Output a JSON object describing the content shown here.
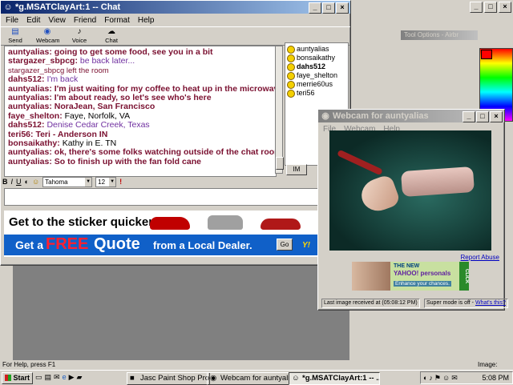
{
  "chat_window": {
    "title": "*g.MSATClayArt:1 -- Chat",
    "menu": [
      "File",
      "Edit",
      "View",
      "Friend",
      "Format",
      "Help"
    ],
    "toolbar": [
      "Send File",
      "Webcam",
      "Voice",
      "Chat"
    ],
    "messages": [
      {
        "user": "auntyalias:",
        "text": "going to get some food, see you in a bit",
        "style": "b"
      },
      {
        "user": "stargazer_sbpcg:",
        "text": "be back later...",
        "style": "purple"
      },
      {
        "user": "",
        "text": "stargazer_sbpcg left the room",
        "style": "sys"
      },
      {
        "user": "dahs512:",
        "text": "I'm back",
        "style": "purple"
      },
      {
        "user": "auntyalias:",
        "text": "I'm just waiting for my coffee to heat up in the microwave",
        "style": "b"
      },
      {
        "user": "auntyalias:",
        "text": "I'm about ready, so let's see who's here",
        "style": "b"
      },
      {
        "user": "auntyalias:",
        "text": "NoraJean, San Francisco",
        "style": "b"
      },
      {
        "user": "faye_shelton:",
        "text": "Faye, Norfolk, VA",
        "style": "plain"
      },
      {
        "user": "dahs512:",
        "text": "Denise Cedar Creek, Texas",
        "style": "purple"
      },
      {
        "user": "teri56:",
        "text": "Teri - Anderson IN",
        "style": "b"
      },
      {
        "user": "bonsaikathy:",
        "text": "Kathy in E. TN",
        "style": "plain"
      },
      {
        "user": "auntyalias:",
        "text": "ok, there's some folks watching outside of the chat room",
        "style": "b"
      },
      {
        "user": "auntyalias:",
        "text": "So to finish up with the fan fold cane",
        "style": "b"
      }
    ],
    "users": [
      "auntyalias",
      "bonsaikathy",
      "dahs512",
      "faye_shelton",
      "merrie60us",
      "teri56"
    ],
    "im_button": "IM",
    "font_name": "Tahoma",
    "font_size": "12",
    "format_buttons": [
      "B",
      "I",
      "U"
    ],
    "ad_line1": "Get to the sticker quicker.",
    "ad_line2a": "Get a",
    "ad_line2b": "FREE",
    "ad_line2c": "Quote",
    "ad_line2d": "from a Local Dealer.",
    "ad_go": "Go"
  },
  "webcam_window": {
    "title": "Webcam for auntyalias",
    "menu": [
      "File",
      "Webcam",
      "Help"
    ],
    "report_abuse": "Report Abuse",
    "ad_the_new": "THE NEW",
    "ad_brand": "YAHOO! personals",
    "ad_tagline": "Enhance your chances.",
    "ad_click": "CLICK",
    "status_left": "Last image received at (05:08:12 PM)",
    "status_right_prefix": "Super mode is off -",
    "status_right_link": "What's this?"
  },
  "background": {
    "tool_options": "Tool Options - Airbr",
    "status_help": "For Help, press F1",
    "status_image": "Image: None"
  },
  "taskbar": {
    "start": "Start",
    "tasks": [
      "Jasc Paint Shop Pro",
      "Webcam for auntyalias",
      "*g.MSATClayArt:1 -- ..."
    ],
    "clock": "5:08 PM"
  }
}
